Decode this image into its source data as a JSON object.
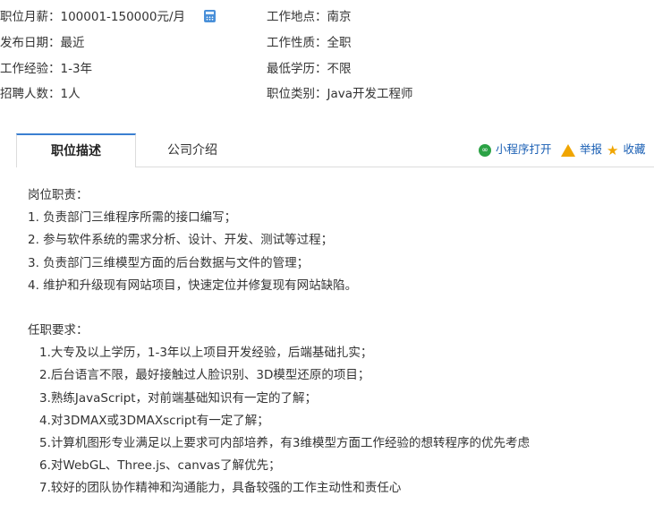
{
  "info": {
    "salary": "职位月薪：100001-150000元/月",
    "location": "工作地点：南京",
    "publish_date": "发布日期：最近",
    "job_nature": "工作性质：全职",
    "experience": "工作经验：1-3年",
    "education": "最低学历：不限",
    "headcount": "招聘人数：1人",
    "category": "职位类别：Java开发工程师"
  },
  "tabs": {
    "description": "职位描述",
    "company": "公司介绍"
  },
  "actions": {
    "mini_program": "小程序打开",
    "report": "举报",
    "favorite": "收藏"
  },
  "duties": {
    "title": "岗位职责：",
    "items": [
      "1. 负责部门三维程序所需的接口编写；",
      "2. 参与软件系统的需求分析、设计、开发、测试等过程；",
      "3. 负责部门三维模型方面的后台数据与文件的管理；",
      "4. 维护和升级现有网站项目，快速定位并修复现有网站缺陷。"
    ]
  },
  "requirements": {
    "title": "任职要求：",
    "items": [
      "1.大专及以上学历，1-3年以上项目开发经验，后端基础扎实；",
      "2.后台语言不限，最好接触过人脸识别、3D模型还原的项目；",
      "3.熟练JavaScript，对前端基础知识有一定的了解；",
      "4.对3DMAX或3DMAXscript有一定了解；",
      "5.计算机图形专业满足以上要求可内部培养，有3维模型方面工作经验的想转程序的优先考虑",
      "6.对WebGL、Three.js、canvas了解优先；",
      "7.较好的团队协作精神和沟通能力，具备较强的工作主动性和责任心"
    ]
  },
  "colors": {
    "accent": "#3b7fd1",
    "link": "#1a5fb4",
    "warning": "#f0a500",
    "wechat": "#2ba245"
  },
  "icons": {
    "calculator": "calculator-icon",
    "mini_program": "mini-program-icon",
    "report": "warning-icon",
    "favorite": "star-icon"
  }
}
